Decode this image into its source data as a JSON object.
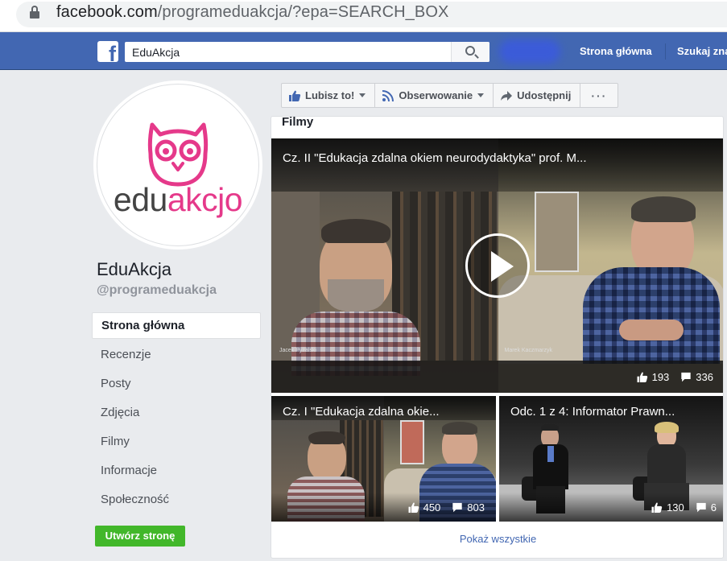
{
  "browser": {
    "url_host": "facebook.com",
    "url_path": "/programeduakcja/?epa=SEARCH_BOX"
  },
  "topbar": {
    "search_value": "EduAkcja",
    "nav_home": "Strona główna",
    "nav_find": "Szukaj zna"
  },
  "profile": {
    "logo_text_edu": "edu",
    "logo_text_akcjo": "akcjo",
    "name": "EduAkcja",
    "handle": "@programeduakcja"
  },
  "sidebar": {
    "items": [
      {
        "label": "Strona główna"
      },
      {
        "label": "Recenzje"
      },
      {
        "label": "Posty"
      },
      {
        "label": "Zdjęcia"
      },
      {
        "label": "Filmy"
      },
      {
        "label": "Informacje"
      },
      {
        "label": "Społeczność"
      }
    ],
    "create_page": "Utwórz stronę"
  },
  "actions": {
    "like": "Lubisz to!",
    "follow": "Obserwowanie",
    "share": "Udostępnij",
    "more": "···"
  },
  "films": {
    "title": "Filmy",
    "show_all": "Pokaż wszystkie",
    "videos": [
      {
        "title": "Cz. II \"Edukacja zdalna okiem neurodydaktyka\" prof. M...",
        "likes": "193",
        "comments": "336",
        "name_left": "Jacek Pyżalski",
        "name_right": "Marek Kaczmarzyk"
      },
      {
        "title": "Cz. I \"Edukacja zdalna okie...",
        "likes": "450",
        "comments": "803"
      },
      {
        "title": "Odc. 1 z 4: Informator Prawn...",
        "likes": "130",
        "comments": "6"
      }
    ]
  },
  "colors": {
    "fb_blue": "#4267b2",
    "brand_pink": "#e5398a",
    "create_green": "#42b72a"
  }
}
